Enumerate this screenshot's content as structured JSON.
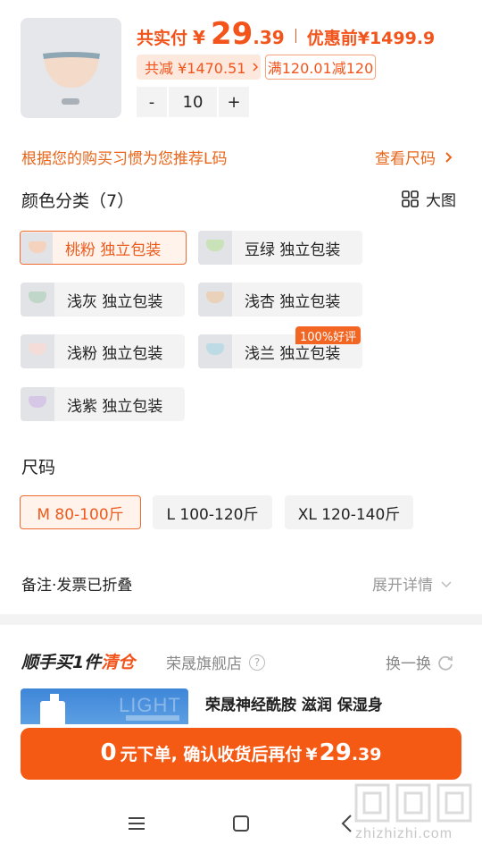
{
  "product": {
    "paid_label": "共实付",
    "currency": "¥",
    "price_int": "29",
    "price_dec": ".39",
    "original_label": "优惠前",
    "original_price": "¥1499.9",
    "total_discount": "共减 ¥1470.51",
    "coupon": "满120.01减120",
    "thumb_tag": "桃粉",
    "quantity": "10",
    "minus_label": "-",
    "plus_label": "+"
  },
  "recommend": {
    "text": "根据您的购买习惯为您推荐L码",
    "size_chart": "查看尺码"
  },
  "colors": {
    "title": "颜色分类（7）",
    "big_view": "大图",
    "options": [
      {
        "label": "桃粉 独立包装",
        "swatch": "#f4d2bd",
        "selected": true
      },
      {
        "label": "豆绿 独立包装",
        "swatch": "#c9e2b8",
        "selected": false
      },
      {
        "label": "浅灰 独立包装",
        "swatch": "#bfd6c8",
        "selected": false
      },
      {
        "label": "浅杏 独立包装",
        "swatch": "#ead1b9",
        "selected": false
      },
      {
        "label": "浅粉 独立包装",
        "swatch": "#f4dcd8",
        "selected": false
      },
      {
        "label": "浅兰 独立包装",
        "swatch": "#bcdbe4",
        "selected": false
      },
      {
        "label": "浅紫 独立包装",
        "swatch": "#d6c7e6",
        "selected": false
      }
    ],
    "badge": "100%好评"
  },
  "sizes": {
    "title": "尺码",
    "options": [
      {
        "label": "M 80-100斤",
        "selected": true
      },
      {
        "label": "L 100-120斤",
        "selected": false
      },
      {
        "label": "XL 120-140斤",
        "selected": false
      }
    ]
  },
  "remark": {
    "text": "备注·发票已折叠",
    "expand": "展开详情"
  },
  "addon": {
    "title_prefix": "顺手买1件",
    "title_highlight": "清仓",
    "store": "荣晟旗舰店",
    "swap": "换一换",
    "product_name": "荣晟神经酰胺 滋润 保湿身",
    "image_text": "LIGHT"
  },
  "cta": {
    "amount": "0",
    "text": "元下单, 确认收货后再付",
    "currency": "¥",
    "price_int": "29",
    "price_dec": ".39"
  },
  "watermark": {
    "site": "zhizhizhi.com"
  },
  "colors_theme": {
    "accent": "#f2541b",
    "cta": "#f55a14"
  }
}
